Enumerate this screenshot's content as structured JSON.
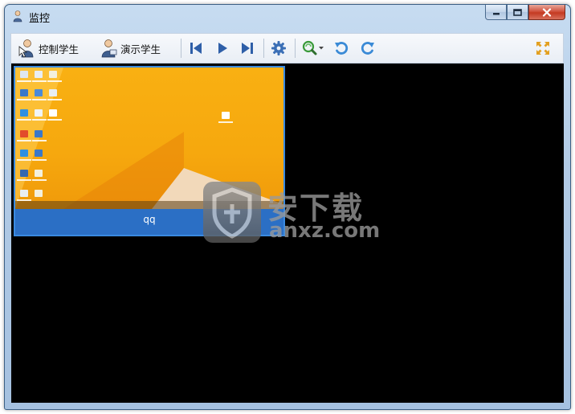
{
  "window": {
    "title": "监控",
    "icons": {
      "app": "student-monitor-icon",
      "minimize": "minimize-icon",
      "maximize": "maximize-icon",
      "close": "close-icon"
    }
  },
  "toolbar": {
    "control_student": {
      "label": "控制学生",
      "icon": "control-student-icon"
    },
    "demo_student": {
      "label": "演示学生",
      "icon": "demo-student-icon"
    },
    "icons": {
      "first": "skip-to-first-icon",
      "play": "play-icon",
      "last": "skip-to-last-icon",
      "settings": "gear-icon",
      "zoom": "zoom-refresh-icon",
      "rotate_left": "rotate-left-icon",
      "rotate_right": "rotate-right-icon",
      "fullscreen": "fullscreen-icon"
    }
  },
  "monitor": {
    "thumbnails": [
      {
        "caption": "qq"
      }
    ]
  },
  "watermark": {
    "text": "安下载",
    "subtext": "anxz.com"
  },
  "colors": {
    "accent": "#2b6fc5",
    "toolbar_icon": "#2f5fa8",
    "gear_icon": "#3b6fb6",
    "rotate_icon": "#3a8ad6",
    "fullscreen_icon": "#e3a020",
    "canvas": "#000000"
  }
}
